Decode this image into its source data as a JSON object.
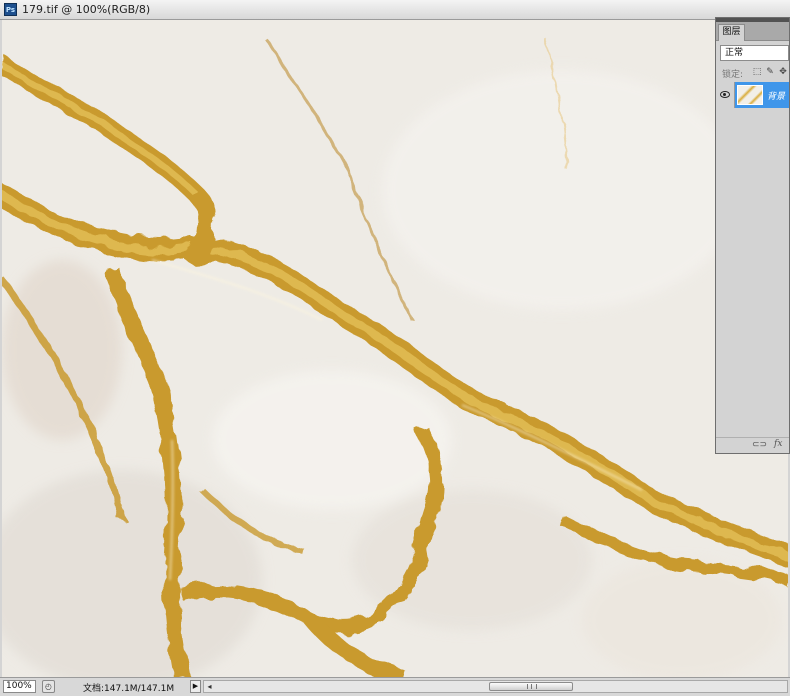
{
  "window": {
    "app_icon_label": "Ps",
    "title": "179.tif @ 100%(RGB/8)"
  },
  "canvas": {
    "content": "marble-texture",
    "colors": {
      "base": "#eeebe5",
      "vein": "#c99a2e",
      "vein_light": "#e2bd55",
      "shadow": "#d8d2c8"
    }
  },
  "layers_panel": {
    "tab_label": "图层",
    "blend_mode": "正常",
    "lock_label": "锁定:",
    "lock_icons": [
      "lock-transparent-icon",
      "lock-paint-icon",
      "lock-move-icon"
    ],
    "layers": [
      {
        "name": "背景",
        "visible": true,
        "selected": true
      }
    ],
    "footer_icons": [
      "link-icon",
      "fx-icon"
    ],
    "fx_label": "fx"
  },
  "statusbar": {
    "zoom": "100%",
    "doc_info": "文档:147.1M/147.1M",
    "scroll_left_glyph": "◂"
  }
}
